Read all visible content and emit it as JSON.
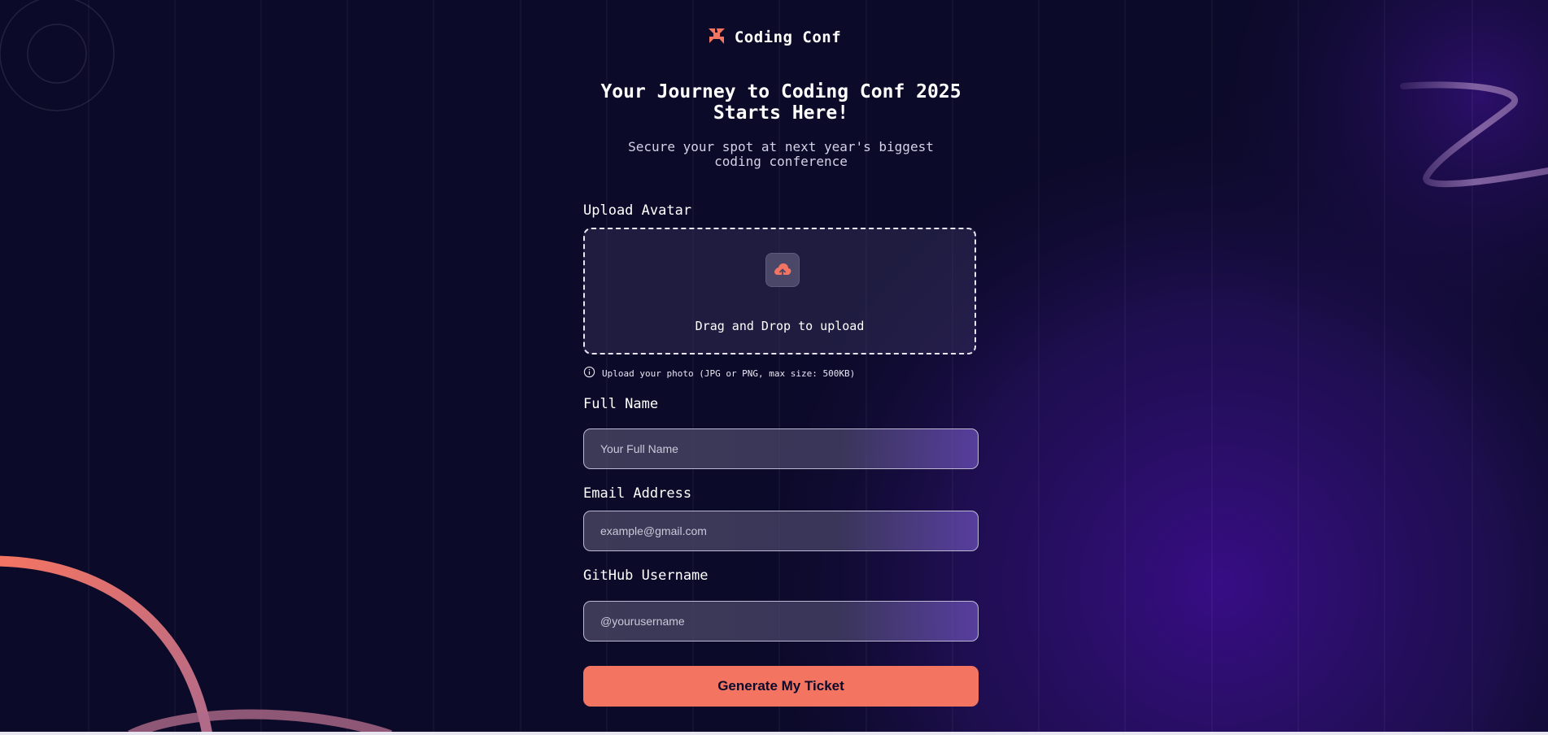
{
  "brand": {
    "name": "Coding Conf",
    "accent": "#f47462",
    "background": "#0c0a2a",
    "glow": "#3a0d8a"
  },
  "hero": {
    "title": "Your Journey to Coding Conf 2025 Starts Here!",
    "subtitle": "Secure your spot at next year's biggest coding conference"
  },
  "form": {
    "avatar": {
      "label": "Upload Avatar",
      "dropzone_text": "Drag and Drop to upload",
      "hint": "Upload your photo (JPG or PNG, max size: 500KB)",
      "icon": "upload-cloud-icon"
    },
    "full_name": {
      "label": "Full Name",
      "placeholder": "Your Full Name",
      "value": ""
    },
    "email": {
      "label": "Email Address",
      "placeholder": "example@gmail.com",
      "value": ""
    },
    "github": {
      "label": "GitHub Username",
      "placeholder": "@yourusername",
      "value": ""
    },
    "submit_label": "Generate My Ticket",
    "info_icon": "info-icon"
  }
}
